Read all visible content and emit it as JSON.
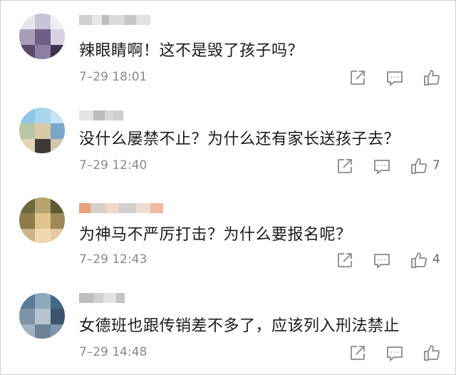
{
  "comments": [
    {
      "text": "辣眼睛啊！这不是毁了孩子吗？",
      "time": "7–29 18:01",
      "likes": "",
      "actions": [
        "share-icon",
        "reply-icon",
        "like-icon"
      ]
    },
    {
      "text": "没什么屡禁不止？为什么还有家长送孩子去？",
      "time": "7–29 12:40",
      "likes": "7",
      "actions": [
        "share-icon",
        "reply-icon",
        "like-icon"
      ]
    },
    {
      "text": "为神马不严厉打击？为什么要报名呢？",
      "time": "7–29 12:43",
      "likes": "4",
      "actions": [
        "share-icon",
        "reply-icon",
        "like-icon"
      ]
    },
    {
      "text": "女德班也跟传销差不多了，应该列入刑法禁止",
      "time": "7–29 14:48",
      "likes": "",
      "actions": [
        "share-icon",
        "reply-icon",
        "like-icon"
      ]
    }
  ],
  "colors": {
    "text": "#1a1a1a",
    "time": "#8a8a8a",
    "icon": "#8a8a8a"
  }
}
